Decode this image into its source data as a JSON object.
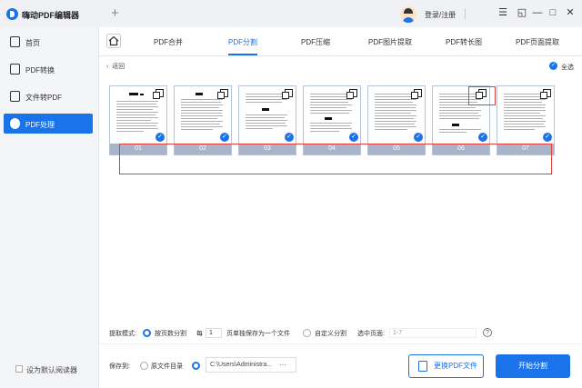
{
  "app": {
    "title": "嗨动PDF编辑器",
    "login_label": "登录/注册"
  },
  "window_controls": {
    "menu": "☰",
    "restore": "◱",
    "minimize": "—",
    "maximize": "□",
    "close": "✕"
  },
  "sidebar": {
    "items": [
      {
        "label": "首页",
        "icon": "home-icon"
      },
      {
        "label": "PDF转换",
        "icon": "file-convert-icon"
      },
      {
        "label": "文件转PDF",
        "icon": "file-to-pdf-icon"
      },
      {
        "label": "PDF处理",
        "icon": "pdf-process-icon",
        "active": true
      }
    ],
    "default_reader_label": "设为默认阅读器"
  },
  "tabs": [
    {
      "label": "PDF合并"
    },
    {
      "label": "PDF分割",
      "active": true
    },
    {
      "label": "PDF压缩"
    },
    {
      "label": "PDF图片提取"
    },
    {
      "label": "PDF转长图"
    },
    {
      "label": "PDF页面提取"
    }
  ],
  "toolbar": {
    "back_label": "返回",
    "select_all_label": "全选"
  },
  "pages": [
    {
      "number": "01",
      "checked": true
    },
    {
      "number": "02",
      "checked": true
    },
    {
      "number": "03",
      "checked": true
    },
    {
      "number": "04",
      "checked": true
    },
    {
      "number": "05",
      "checked": true
    },
    {
      "number": "06",
      "checked": true
    },
    {
      "number": "07",
      "checked": true
    }
  ],
  "split_options": {
    "mode_label": "提取模式:",
    "by_pages_label": "按页数分割",
    "each_label": "每",
    "each_value": "1",
    "each_suffix": "页单独保存为一个文件",
    "custom_label": "自定义分割",
    "selected_pages_label": "选中页面:",
    "selected_pages_placeholder": "1-7",
    "help_icon": "?"
  },
  "save": {
    "label": "保存到:",
    "original_dir_label": "原文件目录",
    "path": "C:\\Users\\Administra...",
    "browse": "···"
  },
  "buttons": {
    "change_pdf": "更换PDF文件",
    "start_split": "开始分割"
  },
  "colors": {
    "accent": "#1a73e8",
    "highlight": "#d9413e"
  }
}
